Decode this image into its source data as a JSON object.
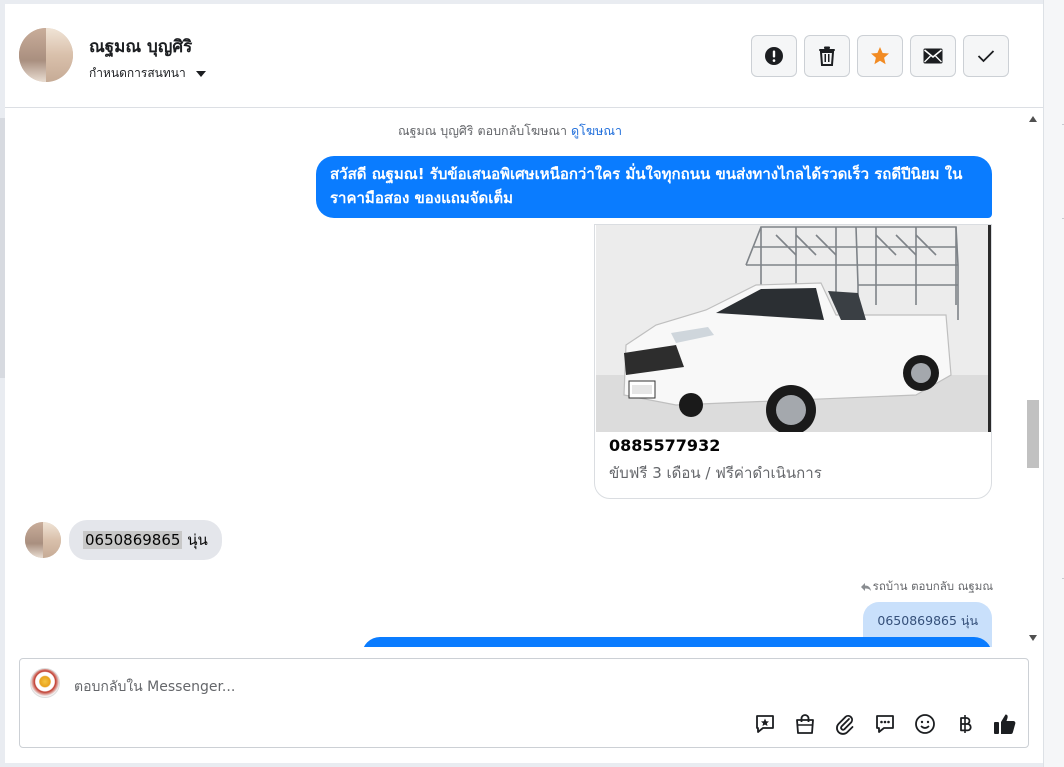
{
  "conversation": {
    "contact_name": "ณฐมณ บุญศิริ",
    "label_dropdown": "กำหนดการสนทนา"
  },
  "header_actions": [
    {
      "name": "report-button",
      "icon": "alert-icon"
    },
    {
      "name": "delete-button",
      "icon": "trash-icon"
    },
    {
      "name": "star-button",
      "icon": "star-icon",
      "color": "#f28b23"
    },
    {
      "name": "unread-button",
      "icon": "envelope-icon"
    },
    {
      "name": "done-button",
      "icon": "check-icon"
    }
  ],
  "messages": {
    "ad_reply_notice": "ณฐมณ บุญศิริ ตอบกลับโฆษณา",
    "view_ad_link": "ดูโฆษณา",
    "outgoing_greeting": "สวัสดี ณฐมณ! รับข้อเสนอพิเศษเหนือกว่าใคร  มั่นใจทุกถนน ขนส่งทางไกลได้รวดเร็ว รถดีปีนิยม ในราคามือสอง ของแถมจัดเต็ม",
    "ad_card": {
      "title": "0885577932",
      "subtitle": "ขับฟรี 3 เดือน / ฟรีค่าดำเนินการ"
    },
    "incoming": {
      "phone_highlight": "0650869865",
      "text_suffix": " นุ่น"
    },
    "reply_note": "รถบ้าน ตอบกลับ ณฐมณ",
    "quoted_message": "0650869865 นุ่น"
  },
  "composer": {
    "placeholder": "ตอบกลับใน Messenger...",
    "tools": [
      "saved-reply-icon",
      "shop-bag-icon",
      "attachment-icon",
      "chat-bubble-icon",
      "emoji-icon",
      "baht-icon",
      "thumbs-up-icon"
    ]
  },
  "colors": {
    "outgoing_bubble": "#0a7cff",
    "incoming_bubble": "#e4e6eb",
    "link": "#216fdb",
    "star": "#f28b23"
  }
}
